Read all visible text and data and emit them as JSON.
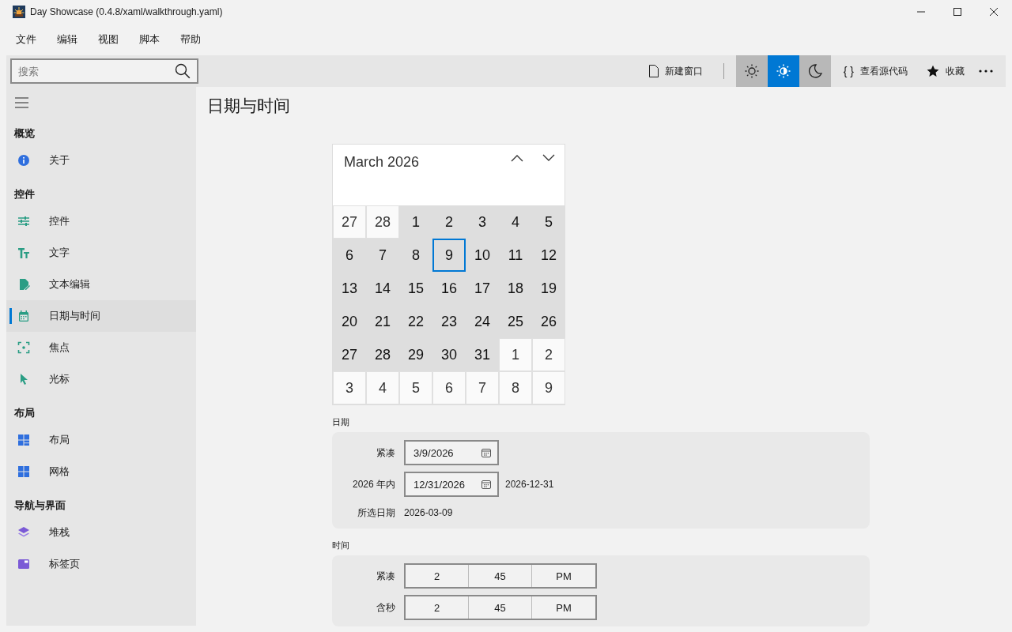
{
  "window": {
    "title": "Day Showcase (0.4.8/xaml/walkthrough.yaml)"
  },
  "menu": [
    "文件",
    "编辑",
    "视图",
    "脚本",
    "帮助"
  ],
  "search": {
    "placeholder": "搜索"
  },
  "toolbar": {
    "new_window": "新建窗口",
    "themes": [
      {
        "selected": false
      },
      {
        "selected": true
      },
      {
        "selected": false
      }
    ],
    "view_source_glyph": "{ }",
    "view_source": "查看源代码",
    "favorite": "收藏"
  },
  "sidebar": {
    "groups": [
      {
        "title": "概览",
        "items": [
          {
            "label": "关于",
            "selected": false
          }
        ]
      },
      {
        "title": "控件",
        "items": [
          {
            "label": "控件",
            "selected": false
          },
          {
            "label": "文字",
            "selected": false
          },
          {
            "label": "文本编辑",
            "selected": false
          },
          {
            "label": "日期与时间",
            "selected": true
          },
          {
            "label": "焦点",
            "selected": false
          },
          {
            "label": "光标",
            "selected": false
          }
        ]
      },
      {
        "title": "布局",
        "items": [
          {
            "label": "布局",
            "selected": false
          },
          {
            "label": "网格",
            "selected": false
          }
        ]
      },
      {
        "title": "导航与界面",
        "items": [
          {
            "label": "堆栈",
            "selected": false
          },
          {
            "label": "标签页",
            "selected": false
          }
        ]
      }
    ]
  },
  "page_title": "日期与时间",
  "calendar": {
    "month": "March 2026",
    "days": [
      {
        "day": "27",
        "in_month": false,
        "selected": false
      },
      {
        "day": "28",
        "in_month": false,
        "selected": false
      },
      {
        "day": "1",
        "in_month": true,
        "selected": false
      },
      {
        "day": "2",
        "in_month": true,
        "selected": false
      },
      {
        "day": "3",
        "in_month": true,
        "selected": false
      },
      {
        "day": "4",
        "in_month": true,
        "selected": false
      },
      {
        "day": "5",
        "in_month": true,
        "selected": false
      },
      {
        "day": "6",
        "in_month": true,
        "selected": false
      },
      {
        "day": "7",
        "in_month": true,
        "selected": false
      },
      {
        "day": "8",
        "in_month": true,
        "selected": false
      },
      {
        "day": "9",
        "in_month": true,
        "selected": true
      },
      {
        "day": "10",
        "in_month": true,
        "selected": false
      },
      {
        "day": "11",
        "in_month": true,
        "selected": false
      },
      {
        "day": "12",
        "in_month": true,
        "selected": false
      },
      {
        "day": "13",
        "in_month": true,
        "selected": false
      },
      {
        "day": "14",
        "in_month": true,
        "selected": false
      },
      {
        "day": "15",
        "in_month": true,
        "selected": false
      },
      {
        "day": "16",
        "in_month": true,
        "selected": false
      },
      {
        "day": "17",
        "in_month": true,
        "selected": false
      },
      {
        "day": "18",
        "in_month": true,
        "selected": false
      },
      {
        "day": "19",
        "in_month": true,
        "selected": false
      },
      {
        "day": "20",
        "in_month": true,
        "selected": false
      },
      {
        "day": "21",
        "in_month": true,
        "selected": false
      },
      {
        "day": "22",
        "in_month": true,
        "selected": false
      },
      {
        "day": "23",
        "in_month": true,
        "selected": false
      },
      {
        "day": "24",
        "in_month": true,
        "selected": false
      },
      {
        "day": "25",
        "in_month": true,
        "selected": false
      },
      {
        "day": "26",
        "in_month": true,
        "selected": false
      },
      {
        "day": "27",
        "in_month": true,
        "selected": false
      },
      {
        "day": "28",
        "in_month": true,
        "selected": false
      },
      {
        "day": "29",
        "in_month": true,
        "selected": false
      },
      {
        "day": "30",
        "in_month": true,
        "selected": false
      },
      {
        "day": "31",
        "in_month": true,
        "selected": false
      },
      {
        "day": "1",
        "in_month": false,
        "selected": false
      },
      {
        "day": "2",
        "in_month": false,
        "selected": false
      },
      {
        "day": "3",
        "in_month": false,
        "selected": false
      },
      {
        "day": "4",
        "in_month": false,
        "selected": false
      },
      {
        "day": "5",
        "in_month": false,
        "selected": false
      },
      {
        "day": "6",
        "in_month": false,
        "selected": false
      },
      {
        "day": "7",
        "in_month": false,
        "selected": false
      },
      {
        "day": "8",
        "in_month": false,
        "selected": false
      },
      {
        "day": "9",
        "in_month": false,
        "selected": false
      }
    ]
  },
  "date_section": {
    "title": "日期",
    "rows": [
      {
        "kind": "picker",
        "label": "紧凑",
        "value": "3/9/2026"
      },
      {
        "kind": "picker",
        "label": "2026 年内",
        "value": "12/31/2026",
        "note": "2026-12-31"
      },
      {
        "kind": "text",
        "label": "所选日期",
        "value": "2026-03-09"
      }
    ]
  },
  "time_section": {
    "title": "时间",
    "rows": [
      {
        "label": "紧凑",
        "parts": [
          "2",
          "45",
          "PM"
        ]
      },
      {
        "label": "含秒",
        "parts": [
          "2",
          "45",
          "PM"
        ]
      }
    ]
  }
}
